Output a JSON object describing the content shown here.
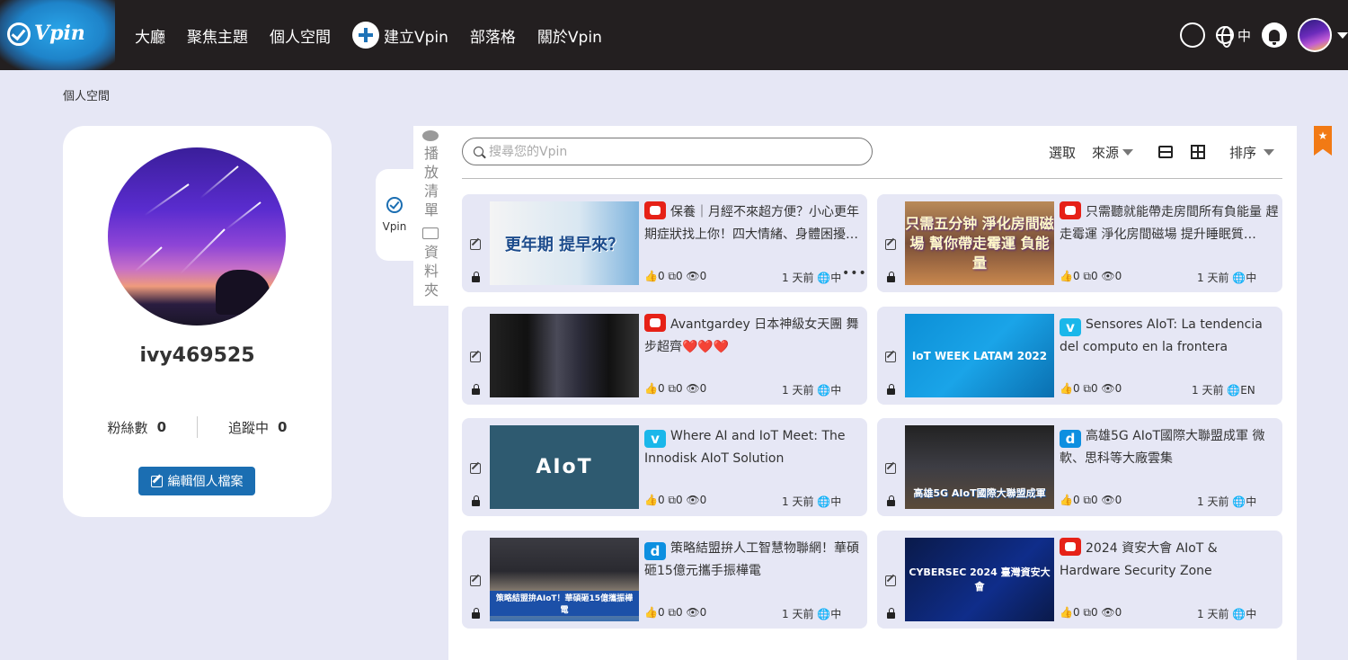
{
  "header": {
    "logo_text": "Vpin",
    "nav": [
      "大廳",
      "聚焦主題",
      "個人空間",
      "建立Vpin",
      "部落格",
      "關於Vpin"
    ],
    "info_icon": "ⓘ",
    "language": "中"
  },
  "breadcrumb": "個人空間",
  "profile": {
    "username": "ivy469525",
    "followers_label": "粉絲數",
    "followers": "0",
    "following_label": "追蹤中",
    "following": "0",
    "edit_label": "編輯個人檔案"
  },
  "tabs": {
    "vpin": "Vpin",
    "playlist": [
      "播",
      "放",
      "清",
      "單"
    ],
    "folder": [
      "資",
      "料",
      "夾"
    ]
  },
  "toolbar": {
    "search_placeholder": "搜尋您的Vpin",
    "select": "選取",
    "source": "來源",
    "sort": "排序"
  },
  "cards": [
    {
      "title": "保養｜月經不來超方便？小心更年期症狀找上你！四大情緒、身體困擾…",
      "source": "youtube",
      "stats": "0 0 0",
      "time": "1 天前",
      "lang": "中",
      "thumb_text": "更年期 提早來？",
      "more": "•••"
    },
    {
      "title": "只需聽就能帶走房間所有負能量 趕走霉運 淨化房間磁場 提升睡眠質…",
      "source": "youtube",
      "stats": "0 0 0",
      "time": "1 天前",
      "lang": "中",
      "thumb_text": "只需五分钟 淨化房間磁場 幫你帶走霉運 負能量"
    },
    {
      "title": "Avantgardey 日本神級女天團 舞步超齊❤️❤️❤️",
      "source": "youtube",
      "stats": "0 0 0",
      "time": "1 天前",
      "lang": "中",
      "thumb_text": ""
    },
    {
      "title": "Sensores AIoT: La tendencia del computo en la frontera",
      "source": "vimeo",
      "stats": "0 0 0",
      "time": "1 天前",
      "lang": "EN",
      "thumb_text": "IoT WEEK LATAM 2022"
    },
    {
      "title": "Where AI and IoT Meet: The Innodisk AIoT Solution",
      "source": "vimeo",
      "stats": "0 0 0",
      "time": "1 天前",
      "lang": "中",
      "thumb_text": "AIoT"
    },
    {
      "title": "高雄5G AIoT國際大聯盟成軍 微軟、思科等大廠雲集",
      "source": "dailymotion",
      "stats": "0 0 0",
      "time": "1 天前",
      "lang": "中",
      "thumb_text": "高雄5G AIoT國際大聯盟成軍"
    },
    {
      "title": "策略結盟拚人工智慧物聯網！華碩砸15億元攜手振樺電",
      "source": "dailymotion",
      "stats": "0 0 0",
      "time": "1 天前",
      "lang": "中",
      "thumb_text": "策略結盟拚AIoT！華碩砸15億攜振樺電"
    },
    {
      "title": "2024 資安大會 AIoT & Hardware Security Zone",
      "source": "youtube",
      "stats": "0 0 0",
      "time": "1 天前",
      "lang": "中",
      "thumb_text": "CYBERSEC 2024 臺灣資安大會"
    }
  ]
}
